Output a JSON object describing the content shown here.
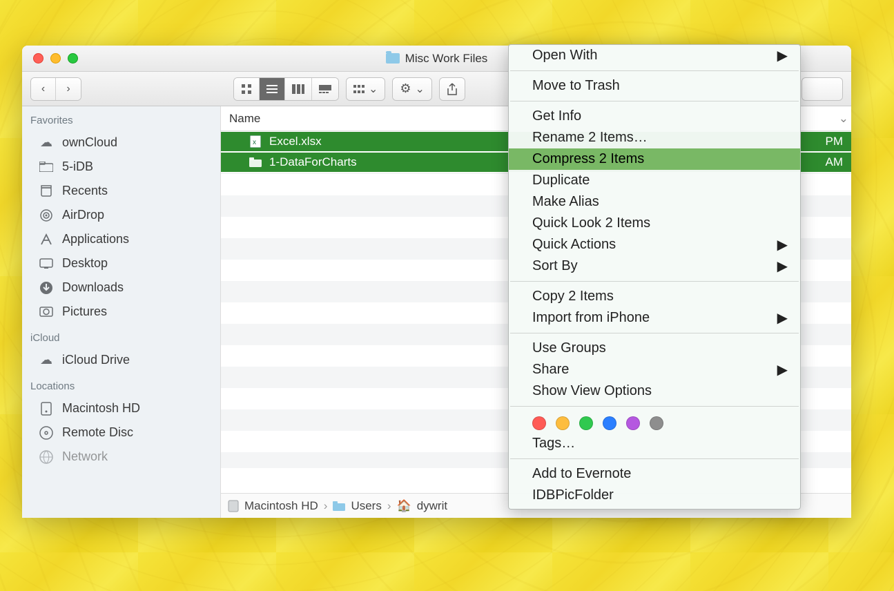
{
  "window": {
    "title": "Misc Work Files"
  },
  "sidebar": {
    "sections": [
      {
        "title": "Favorites",
        "items": [
          {
            "label": "ownCloud"
          },
          {
            "label": "5-iDB"
          },
          {
            "label": "Recents"
          },
          {
            "label": "AirDrop"
          },
          {
            "label": "Applications"
          },
          {
            "label": "Desktop"
          },
          {
            "label": "Downloads"
          },
          {
            "label": "Pictures"
          }
        ]
      },
      {
        "title": "iCloud",
        "items": [
          {
            "label": "iCloud Drive"
          }
        ]
      },
      {
        "title": "Locations",
        "items": [
          {
            "label": "Macintosh HD"
          },
          {
            "label": "Remote Disc"
          },
          {
            "label": "Network"
          }
        ]
      }
    ]
  },
  "columns": {
    "name": "Name"
  },
  "files": [
    {
      "name": "Excel.xlsx",
      "date": "PM"
    },
    {
      "name": "1-DataForCharts",
      "date": "AM"
    }
  ],
  "pathbar": [
    "Macintosh HD",
    "Users",
    "dywrit"
  ],
  "context_menu": {
    "groups": [
      [
        {
          "label": "Open With",
          "submenu": true
        }
      ],
      [
        {
          "label": "Move to Trash"
        }
      ],
      [
        {
          "label": "Get Info"
        },
        {
          "label": "Rename 2 Items…"
        },
        {
          "label": "Compress 2 Items",
          "highlight": true
        },
        {
          "label": "Duplicate"
        },
        {
          "label": "Make Alias"
        },
        {
          "label": "Quick Look 2 Items"
        },
        {
          "label": "Quick Actions",
          "submenu": true
        },
        {
          "label": "Sort By",
          "submenu": true
        }
      ],
      [
        {
          "label": "Copy 2 Items"
        },
        {
          "label": "Import from iPhone",
          "submenu": true
        }
      ],
      [
        {
          "label": "Use Groups"
        },
        {
          "label": "Share",
          "submenu": true
        },
        {
          "label": "Show View Options"
        }
      ]
    ],
    "tags_label": "Tags…",
    "extra": [
      {
        "label": "Add to Evernote"
      },
      {
        "label": "IDBPicFolder"
      }
    ]
  }
}
